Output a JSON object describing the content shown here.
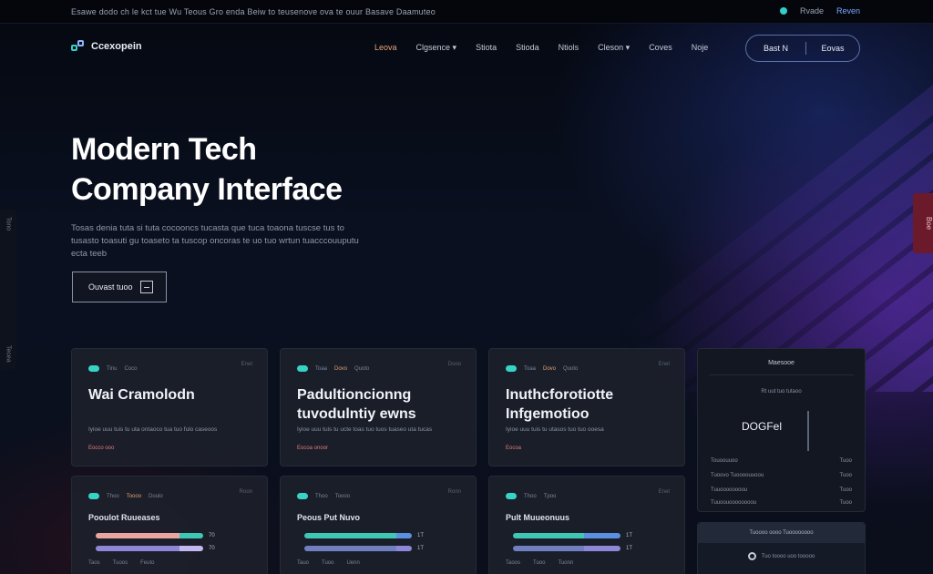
{
  "topbar": {
    "message": "Esawe dodo ch le kct tue  Wu Teous Gro enda Beiw to teusenove ova te ouur Basave Daamuteo",
    "right_items": [
      "Rvade",
      "Reven"
    ]
  },
  "nav": {
    "brand": "Ccexopein",
    "menu": [
      "Leova",
      "Clgsence ▾",
      "Stiota",
      "Stioda",
      "Ntiols",
      "Cleson ▾",
      "Coves",
      "Noje"
    ],
    "btn_primary": "Bast N",
    "btn_secondary": "Eovas"
  },
  "hero": {
    "title_line1": "Modern Tech",
    "title_line2": "Company Interface",
    "body": "Tosas denia tuta si tuta cocooncs tucasta que tuca toaona tuscse tus to tusasto toasuti gu toaseto ta tuscop oncoras te uo tuo wrtun tuacccouuputu ecta teeb",
    "cta_label": "Ouvast tuoo"
  },
  "side_left": {
    "top": "Tono",
    "bottom": "Tecea"
  },
  "side_right": {
    "label": "Boe"
  },
  "cards": [
    {
      "tags": [
        "Tinu",
        "Coco"
      ],
      "more": "Enet",
      "title": "Wai Cramolodn",
      "desc": "Iyioe uuu tuis tu uta ontaoco tua tuo fulo caseoos",
      "link": "Eocco ooo"
    },
    {
      "tags": [
        "Toaa",
        "Dovo",
        "Quoto"
      ],
      "more": "Dooo",
      "title": "Padultioncionng tuvodulntiy ewns",
      "desc": "Iyioe uuu tuis tu ucte toas tuo tuos tuaseo uta tucas",
      "link": "Eocoa onoor"
    },
    {
      "tags": [
        "Toaa",
        "Dovo",
        "Quoto"
      ],
      "more": "Enet",
      "title": "Inuthcforotiotte Infgemotioo",
      "desc": "Iyioe uuu tuis tu utasos tuo tuo ooesa",
      "link": "Eocoa"
    }
  ],
  "metric_cards": [
    {
      "tags": [
        "Thoo",
        "Toooo",
        "Doulo"
      ],
      "more": "Roon",
      "title": "Pooulot Ruueases",
      "bars": [
        {
          "value": "70",
          "fill": 0.78,
          "colors": [
            "#e9a6a0",
            "#3ec7b5"
          ]
        },
        {
          "value": "70",
          "fill": 0.78,
          "colors": [
            "#8e86d8",
            "#c3b8f2"
          ]
        }
      ],
      "labels": [
        "Taos",
        "Tuoos",
        "Feuto"
      ]
    },
    {
      "tags": [
        "Thoo",
        "Toooo"
      ],
      "more": "Ronn",
      "title": "Peous Put Nuvo",
      "bars": [
        {
          "value": "1T",
          "fill": 0.86,
          "colors": [
            "#3ec7b5",
            "#5b8fe0"
          ]
        },
        {
          "value": "1T",
          "fill": 0.86,
          "colors": [
            "#6f7fbf",
            "#8e86d8"
          ]
        }
      ],
      "labels": [
        "Tauo",
        "Tuoo",
        "Uenn"
      ]
    },
    {
      "tags": [
        "Thoo",
        "Tpoo"
      ],
      "more": "Enet",
      "title": "Pult Muueonuus",
      "bars": [
        {
          "value": "1T",
          "fill": 0.66,
          "colors": [
            "#3ec7b5",
            "#5b8fe0"
          ]
        },
        {
          "value": "1T",
          "fill": 0.66,
          "colors": [
            "#6f7fbf",
            "#8e86d8"
          ]
        }
      ],
      "labels": [
        "Taoos",
        "Tuoo",
        "Tuonn"
      ]
    }
  ],
  "panel": {
    "title": "Maesooe",
    "subtitle": "Rt  uut tuo tutaoo",
    "big_value": "DOGFel",
    "rows": [
      [
        "Touoouuoo",
        "Tuoo"
      ],
      [
        "Tuoovo Tuoooouuoou",
        "Tuoo"
      ],
      [
        "Tuuoooooooou",
        "Tuoo"
      ],
      [
        "Tuuoouoooooooou",
        "Tuoo"
      ]
    ]
  },
  "panel2": {
    "header": "Tuoooo oooo Tuoooooooo",
    "row": "Tuo toooo uoo tooooo"
  }
}
